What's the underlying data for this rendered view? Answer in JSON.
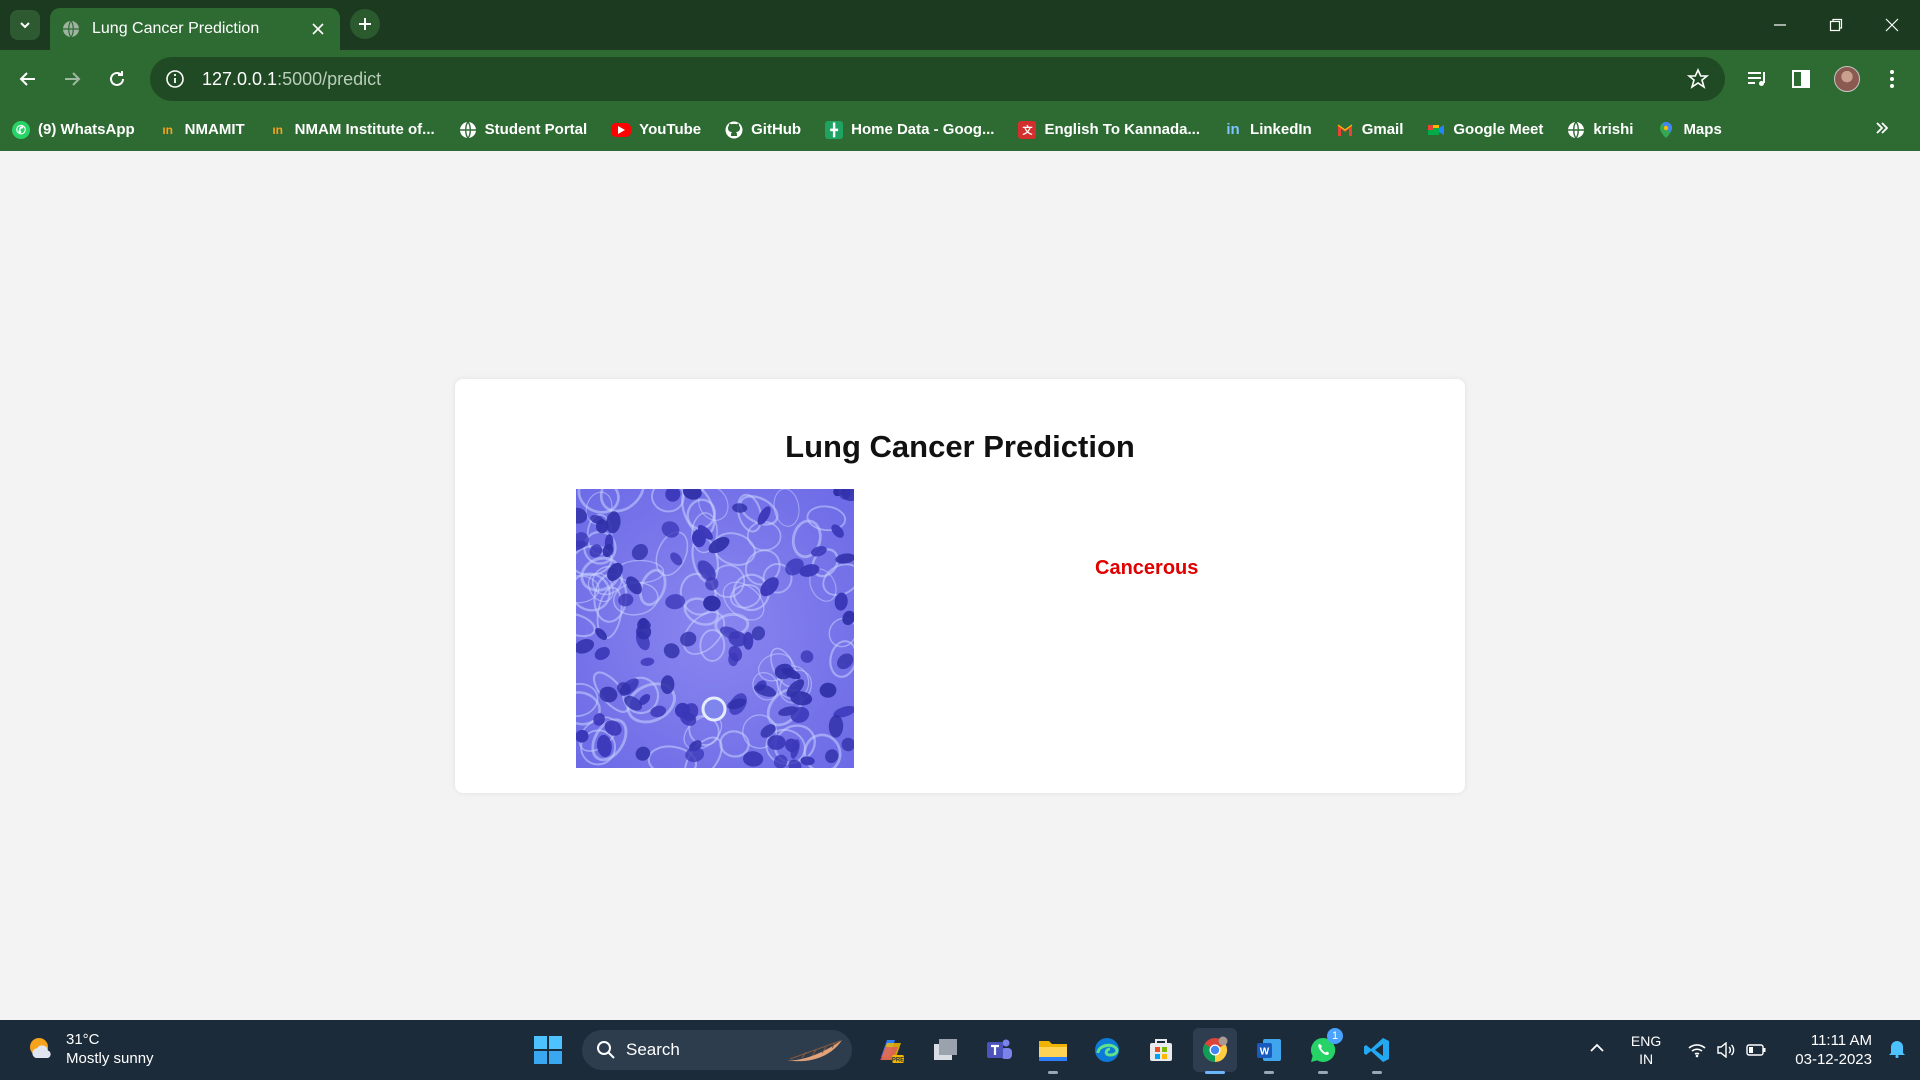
{
  "browser": {
    "tab_title": "Lung Cancer Prediction",
    "url_host": "127.0.0.1",
    "url_path": ":5000/predict"
  },
  "bookmarks": [
    {
      "label": "(9) WhatsApp",
      "icon": "whatsapp-icon"
    },
    {
      "label": "NMAMIT",
      "icon": "nmamit-icon"
    },
    {
      "label": "NMAM Institute of...",
      "icon": "nmamit-icon"
    },
    {
      "label": "Student Portal",
      "icon": "globe-icon"
    },
    {
      "label": "YouTube",
      "icon": "youtube-icon"
    },
    {
      "label": "GitHub",
      "icon": "github-icon"
    },
    {
      "label": "Home Data - Goog...",
      "icon": "sheets-icon"
    },
    {
      "label": "English To Kannada...",
      "icon": "translate-icon"
    },
    {
      "label": "LinkedIn",
      "icon": "linkedin-icon"
    },
    {
      "label": "Gmail",
      "icon": "gmail-icon"
    },
    {
      "label": "Google Meet",
      "icon": "meet-icon"
    },
    {
      "label": "krishi",
      "icon": "globe-icon"
    },
    {
      "label": "Maps",
      "icon": "maps-icon"
    }
  ],
  "page": {
    "heading": "Lung Cancer Prediction",
    "result_label": "Cancerous",
    "result_color": "#e00000"
  },
  "taskbar": {
    "weather_temp": "31°C",
    "weather_desc": "Mostly sunny",
    "search_placeholder": "Search",
    "lang_line1": "ENG",
    "lang_line2": "IN",
    "time": "11:11 AM",
    "date": "03-12-2023",
    "whatsapp_badge": "1"
  }
}
